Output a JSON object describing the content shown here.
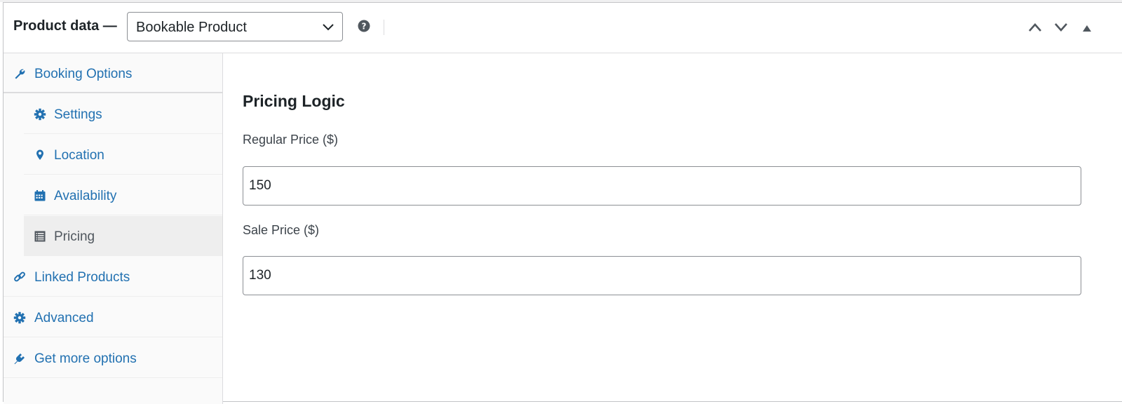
{
  "header": {
    "title": "Product data —",
    "product_type": "Bookable Product",
    "help_icon": "question-circle-icon",
    "controls": [
      "move-up-icon",
      "move-down-icon",
      "collapse-toggle-icon"
    ]
  },
  "sidebar": {
    "items": [
      {
        "label": "Booking Options",
        "icon": "wrench-icon",
        "level": "top"
      },
      {
        "label": "Settings",
        "icon": "gear-icon",
        "level": "sub"
      },
      {
        "label": "Location",
        "icon": "location-pin-icon",
        "level": "sub"
      },
      {
        "label": "Availability",
        "icon": "calendar-icon",
        "level": "sub"
      },
      {
        "label": "Pricing",
        "icon": "table-icon",
        "level": "sub",
        "active": true
      },
      {
        "label": "Linked Products",
        "icon": "link-icon",
        "level": "top"
      },
      {
        "label": "Advanced",
        "icon": "gear-icon",
        "level": "top"
      },
      {
        "label": "Get more options",
        "icon": "plugin-icon",
        "level": "top"
      }
    ]
  },
  "main": {
    "section_title": "Pricing Logic",
    "regular_price": {
      "label": "Regular Price ($)",
      "value": "150"
    },
    "sale_price": {
      "label": "Sale Price ($)",
      "value": "130"
    }
  },
  "colors": {
    "link": "#2271b1",
    "active_bg": "#eeeeee",
    "sidebar_bg": "#fafafa",
    "border": "#dcdcde",
    "text": "#1d2327"
  }
}
